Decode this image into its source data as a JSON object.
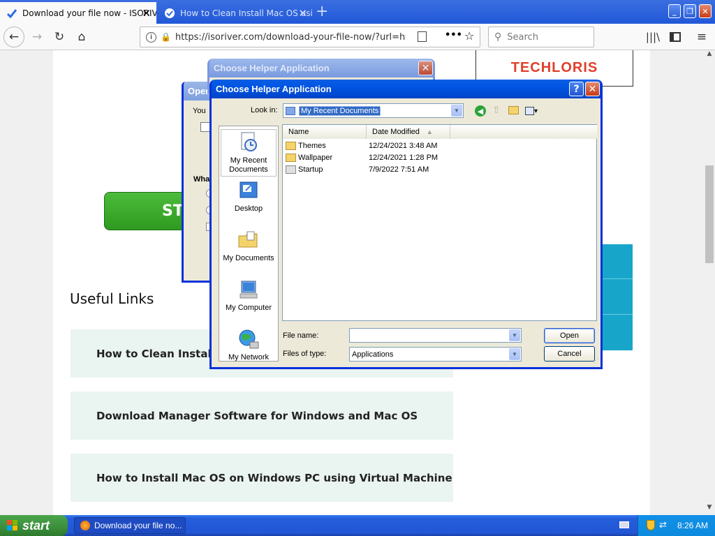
{
  "browser": {
    "tabs": [
      {
        "title": "Download your file now - ISORIVER",
        "active": true
      },
      {
        "title": "How to Clean Install Mac OS using",
        "active": false
      }
    ],
    "url": "https://isoriver.com/download-your-file-now/?url=http",
    "search_placeholder": "Search"
  },
  "page": {
    "logo_text": "TECHLORIS",
    "green_button_partial": "ST",
    "useful_links_heading": "Useful Links",
    "links": [
      "How to Clean Install W",
      "Download Manager Software for Windows and Mac OS",
      "How to Install Mac OS on Windows PC using Virtual Machine"
    ]
  },
  "bg_dialog": {
    "title": "Choose Helper Application"
  },
  "open_dialog_partial": {
    "title": "Open",
    "text1": "You",
    "text2": "Wha"
  },
  "file_dialog": {
    "title": "Choose Helper Application",
    "look_in_label": "Look in:",
    "look_in_value": "My Recent Documents",
    "places": [
      {
        "label": "My Recent Documents",
        "icon": "recent-documents-icon"
      },
      {
        "label": "Desktop",
        "icon": "desktop-icon"
      },
      {
        "label": "My Documents",
        "icon": "my-documents-icon"
      },
      {
        "label": "My Computer",
        "icon": "my-computer-icon"
      },
      {
        "label": "My Network",
        "icon": "my-network-icon"
      }
    ],
    "columns": {
      "name": "Name",
      "date": "Date Modified"
    },
    "files": [
      {
        "name": "Themes",
        "date": "12/24/2021 3:48 AM"
      },
      {
        "name": "Wallpaper",
        "date": "12/24/2021 1:28 PM"
      },
      {
        "name": "Startup",
        "date": "7/9/2022 7:51 AM"
      }
    ],
    "file_name_label": "File name:",
    "file_name_value": "",
    "files_of_type_label": "Files of type:",
    "files_of_type_value": "Applications",
    "open_label": "Open",
    "cancel_label": "Cancel"
  },
  "taskbar": {
    "start_label": "start",
    "task_item": "Download your file no...",
    "clock": "8:26 AM"
  }
}
